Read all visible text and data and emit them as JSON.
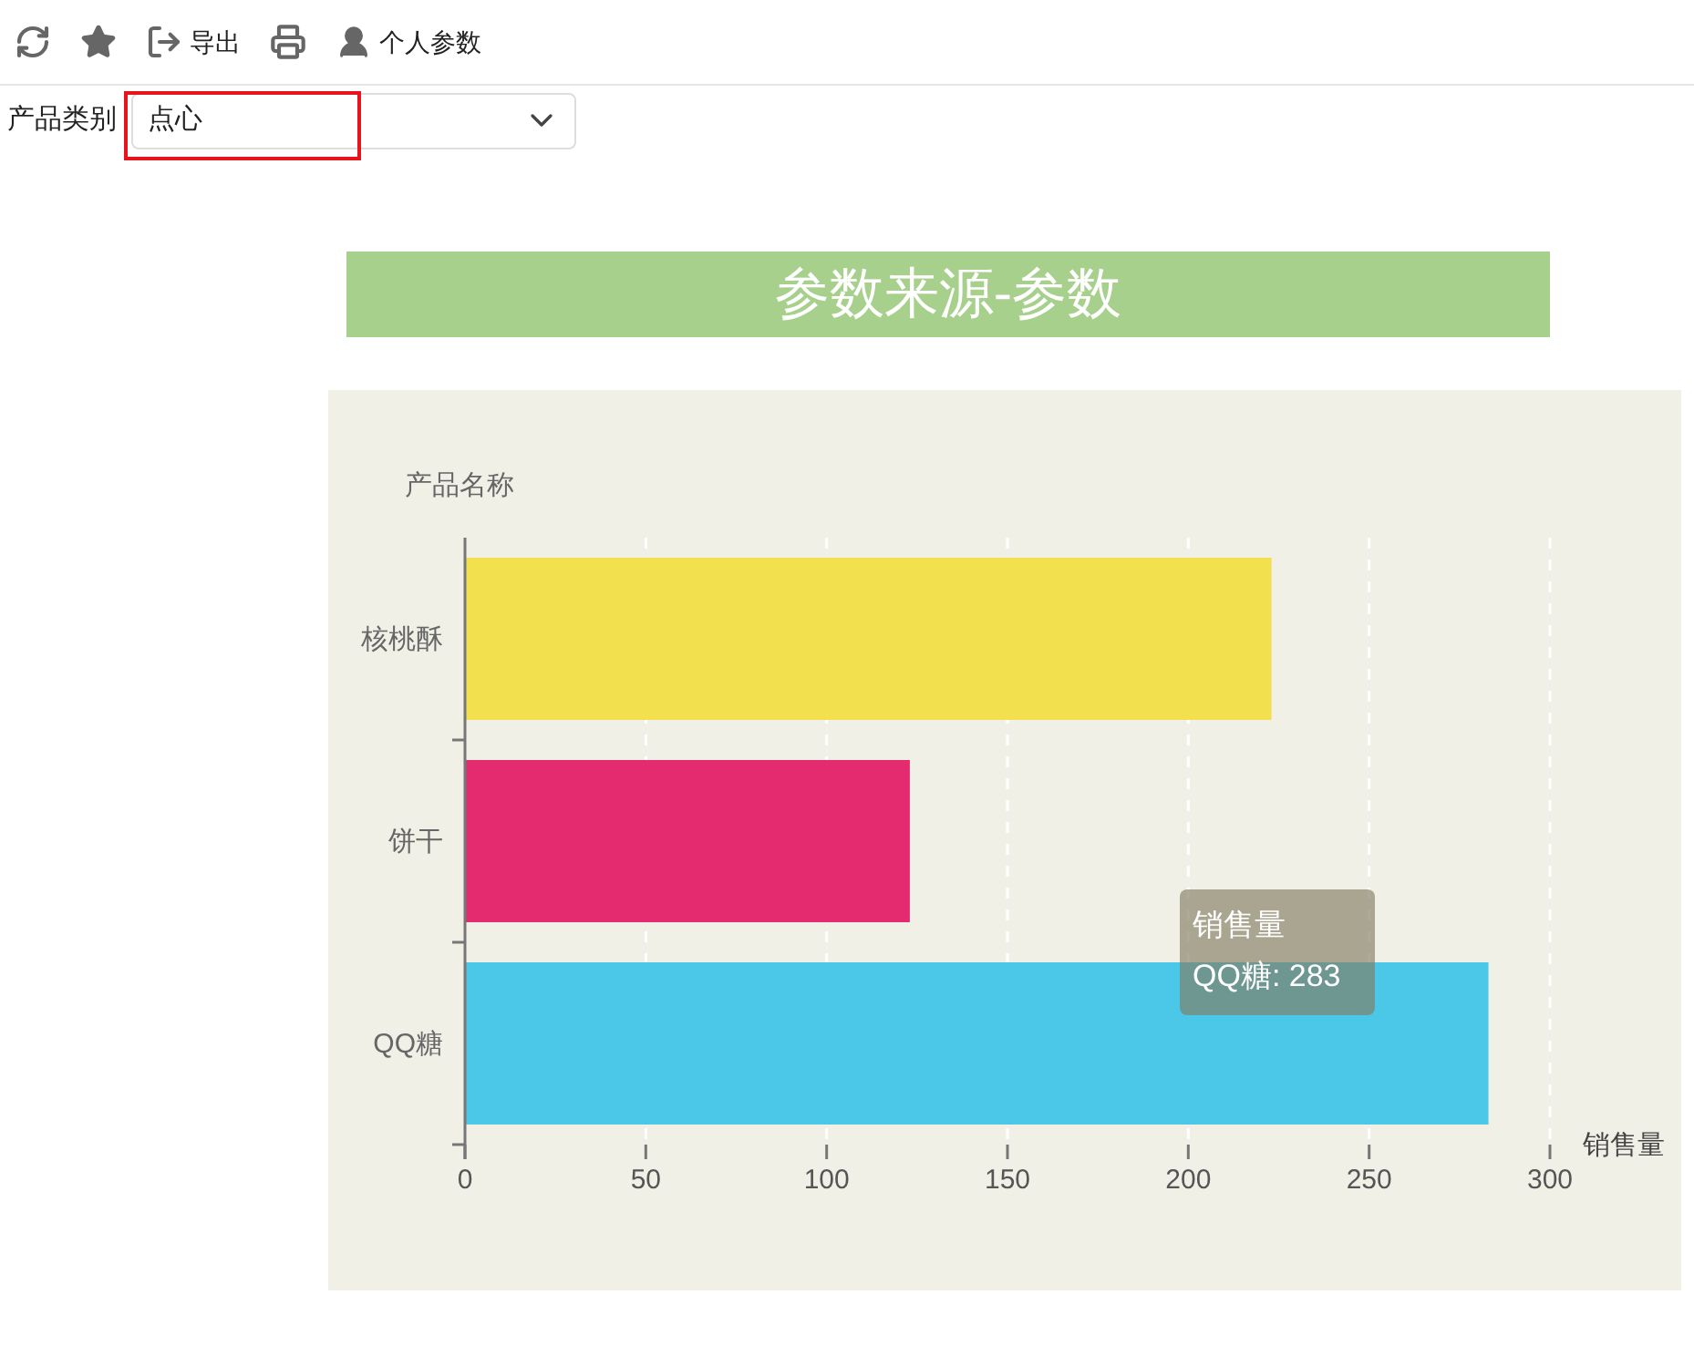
{
  "toolbar": [
    {
      "kind": "refresh"
    },
    {
      "kind": "favorite"
    },
    {
      "kind": "export",
      "label": "导出"
    },
    {
      "kind": "print"
    },
    {
      "kind": "user",
      "label": "个人参数"
    }
  ],
  "filter": {
    "label": "产品类别",
    "value": "点心",
    "highlighted": true
  },
  "title": "参数来源-参数",
  "chart": {
    "chart_data": {
      "type": "bar",
      "orientation": "horizontal",
      "xlabel": "销售量",
      "ylabel": "产品名称",
      "categories": [
        "核桃酥",
        "饼干",
        "QQ糖"
      ],
      "series": [
        {
          "name": "销售量",
          "values": [
            223,
            123,
            283
          ],
          "colors": [
            "#f3e04f",
            "#e42b6f",
            "#4bc8e8"
          ]
        }
      ],
      "xlim": [
        0,
        300
      ],
      "xticks": [
        0,
        50,
        100,
        150,
        200,
        250,
        300
      ],
      "grid": true
    },
    "tooltip": {
      "text": "QQ糖: 283"
    }
  }
}
